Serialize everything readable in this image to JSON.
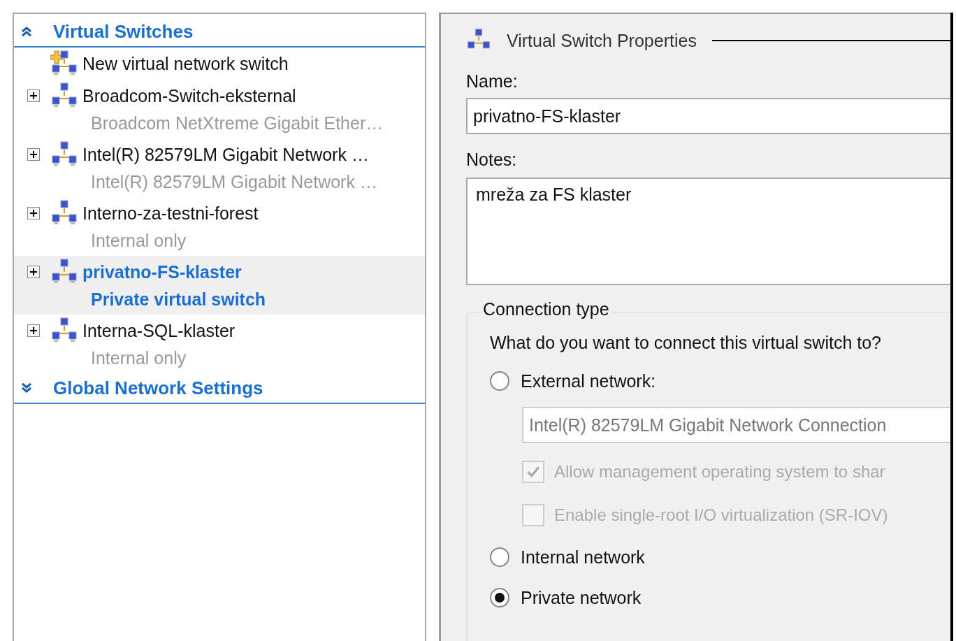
{
  "sidebar": {
    "sections": [
      {
        "title": "Virtual Switches",
        "expanded": true,
        "items": [
          {
            "kind": "new",
            "name": "New virtual network switch"
          },
          {
            "kind": "switch",
            "name": "Broadcom-Switch-eksternal",
            "detail": "Broadcom NetXtreme Gigabit Ether…",
            "expanded": false,
            "selected": false
          },
          {
            "kind": "switch",
            "name": "Intel(R) 82579LM Gigabit Network …",
            "detail": "Intel(R) 82579LM Gigabit Network …",
            "expanded": false,
            "selected": false
          },
          {
            "kind": "switch",
            "name": "Interno-za-testni-forest",
            "detail": "Internal only",
            "expanded": false,
            "selected": false
          },
          {
            "kind": "switch",
            "name": "privatno-FS-klaster",
            "detail": "Private virtual switch",
            "expanded": false,
            "selected": true
          },
          {
            "kind": "switch",
            "name": "Interna-SQL-klaster",
            "detail": "Internal only",
            "expanded": false,
            "selected": false
          }
        ]
      },
      {
        "title": "Global Network Settings",
        "expanded": false
      }
    ]
  },
  "properties": {
    "title": "Virtual Switch Properties",
    "name_label": "Name:",
    "name_value": "privatno-FS-klaster",
    "notes_label": "Notes:",
    "notes_value": "mreža za FS klaster",
    "connection": {
      "legend": "Connection type",
      "question": "What do you want to connect this virtual switch to?",
      "options": [
        {
          "kind": "radio",
          "label": "External network:",
          "selected": false
        },
        {
          "kind": "dropdown",
          "value": "Intel(R) 82579LM Gigabit Network Connection",
          "disabled": true
        },
        {
          "kind": "checkbox",
          "label": "Allow management operating system to shar",
          "checked": true,
          "disabled": true
        },
        {
          "kind": "checkbox",
          "label": "Enable single-root I/O virtualization (SR-IOV)",
          "checked": false,
          "disabled": true
        },
        {
          "kind": "radio",
          "label": "Internal network",
          "selected": false
        },
        {
          "kind": "radio",
          "label": "Private network",
          "selected": true
        }
      ]
    }
  }
}
